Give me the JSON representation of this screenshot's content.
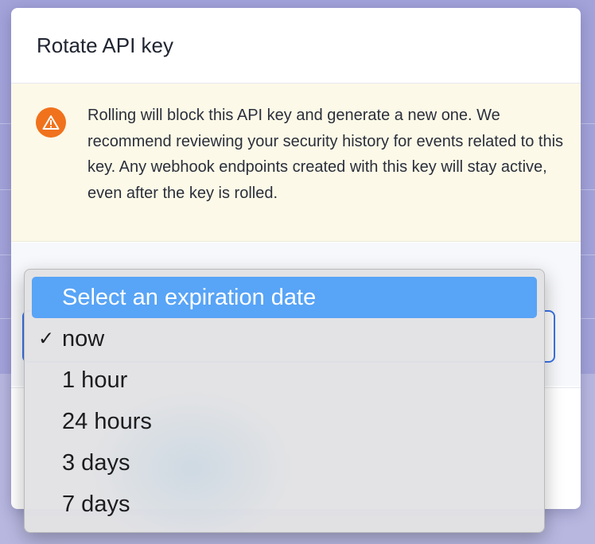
{
  "modal": {
    "title": "Rotate API key"
  },
  "warning": {
    "icon": "warning-icon",
    "color": "#f0721c",
    "text": "Rolling will block this API key and generate a new one. We recommend reviewing your security history for events related to this key. Any webhook endpoints created with this key will stay active, even after the key is rolled."
  },
  "dropdown": {
    "header": "Select an expiration date",
    "selected": "now",
    "check_mark": "✓",
    "options": [
      "now",
      "1 hour",
      "24 hours",
      "3 days",
      "7 days"
    ]
  },
  "colors": {
    "highlight": "#58a4f6",
    "select_border": "#3b73e8",
    "backdrop": "#9b9bd3"
  }
}
